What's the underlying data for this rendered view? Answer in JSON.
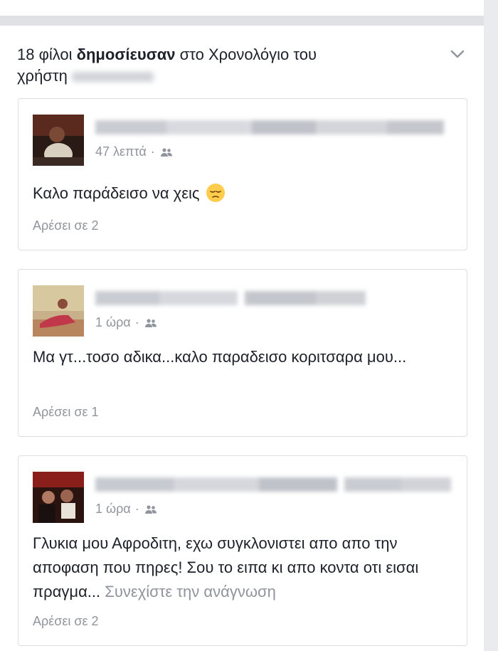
{
  "header": {
    "prefix": "18 φίλοι ",
    "bold": "δημοσίευσαν",
    "rest_line1": " στο Χρονολόγιο του",
    "line2": "χρήστη"
  },
  "posts": [
    {
      "time": "47 λεπτά",
      "separator": "·",
      "text": "Καλο  παράδεισο να χεις",
      "likes": "Αρέσει σε 2"
    },
    {
      "time": "1 ώρα",
      "separator": "·",
      "text": "Μα γτ...τοσο αδικα...καλο παραδεισο κοριτσαρα μου...",
      "likes": "Αρέσει σε 1"
    },
    {
      "time": "1 ώρα",
      "separator": "·",
      "text": "Γλυκια μου Αφροδιτη, εχω συγκλονιστει απο απο την αποφαση που πηρες!  Σου το ειπα κι απο κοντα οτι εισαι πραγμα...",
      "more": "Συνεχίστε την ανάγνωση",
      "likes": "Αρέσει σε 2"
    }
  ],
  "icons": {
    "chevron": "chevron-down-icon",
    "audience": "friends-icon",
    "emoji": "pensive-face-icon"
  },
  "colors": {
    "text": "#1d2129",
    "secondary": "#90949c",
    "border": "#dcdee3",
    "bar": "#dfe1e5"
  }
}
